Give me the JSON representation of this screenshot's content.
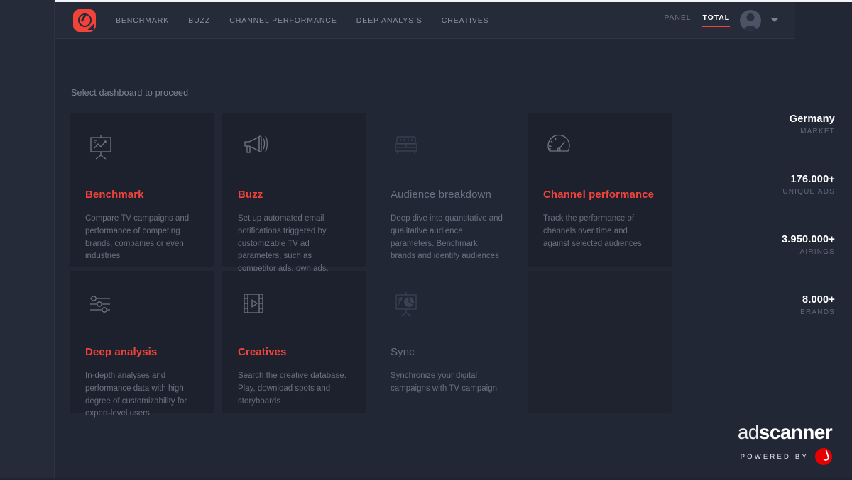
{
  "header": {
    "logo_name": "adscanner-logo",
    "nav": [
      {
        "label": "BENCHMARK",
        "name": "nav-benchmark"
      },
      {
        "label": "BUZZ",
        "name": "nav-buzz"
      },
      {
        "label": "CHANNEL PERFORMANCE",
        "name": "nav-channel-performance"
      },
      {
        "label": "DEEP ANALYSIS",
        "name": "nav-deep-analysis"
      },
      {
        "label": "CREATIVES",
        "name": "nav-creatives"
      }
    ],
    "scope_tabs": [
      {
        "label": "PANEL",
        "active": false
      },
      {
        "label": "TOTAL",
        "active": true
      }
    ]
  },
  "main": {
    "prompt": "Select dashboard to proceed",
    "cards": [
      {
        "title": "Benchmark",
        "description": "Compare TV campaigns and performance of competing brands, companies or even industries",
        "icon": "presentation-chart-icon",
        "enabled": true
      },
      {
        "title": "Buzz",
        "description": "Set up automated email notifications triggered by customizable TV ad parameters, such as competitor ads, own ads, campaign thresholds",
        "icon": "megaphone-icon",
        "enabled": true
      },
      {
        "title": "Audience breakdown",
        "description": "Deep dive into quantitative and qualitative audience parameters. Benchmark brands and identify audiences",
        "icon": "sofa-icon",
        "enabled": false
      },
      {
        "title": "Channel performance",
        "description": "Track the performance of channels over time and against selected audiences",
        "icon": "speedometer-icon",
        "enabled": true
      },
      {
        "title": "Deep analysis",
        "description": "In-depth analyses and performance data with high degree of customizability for expert-level users",
        "icon": "sliders-icon",
        "enabled": true
      },
      {
        "title": "Creatives",
        "description": "Search the creative database. Play, download spots and storyboards",
        "icon": "film-play-icon",
        "enabled": true
      },
      {
        "title": "Sync",
        "description": "Synchronize your digital campaigns with TV campaign",
        "icon": "presentation-pie-icon",
        "enabled": false
      }
    ]
  },
  "stats": [
    {
      "value": "Germany",
      "label": "MARKET"
    },
    {
      "value": "176.000+",
      "label": "UNIQUE ADS"
    },
    {
      "value": "3.950.000+",
      "label": "AIRINGS"
    },
    {
      "value": "8.000+",
      "label": "BRANDS"
    }
  ],
  "brand": {
    "word_first": "ad",
    "word_rest": "scanner",
    "powered_by": "POWERED BY",
    "mark_name": "vodafone-mark"
  },
  "colors": {
    "accent": "#f2433b",
    "page_bg": "#222735",
    "card_bg": "#1d212d",
    "muted_text": "#6a7082",
    "vodafone_red": "#e60000"
  }
}
